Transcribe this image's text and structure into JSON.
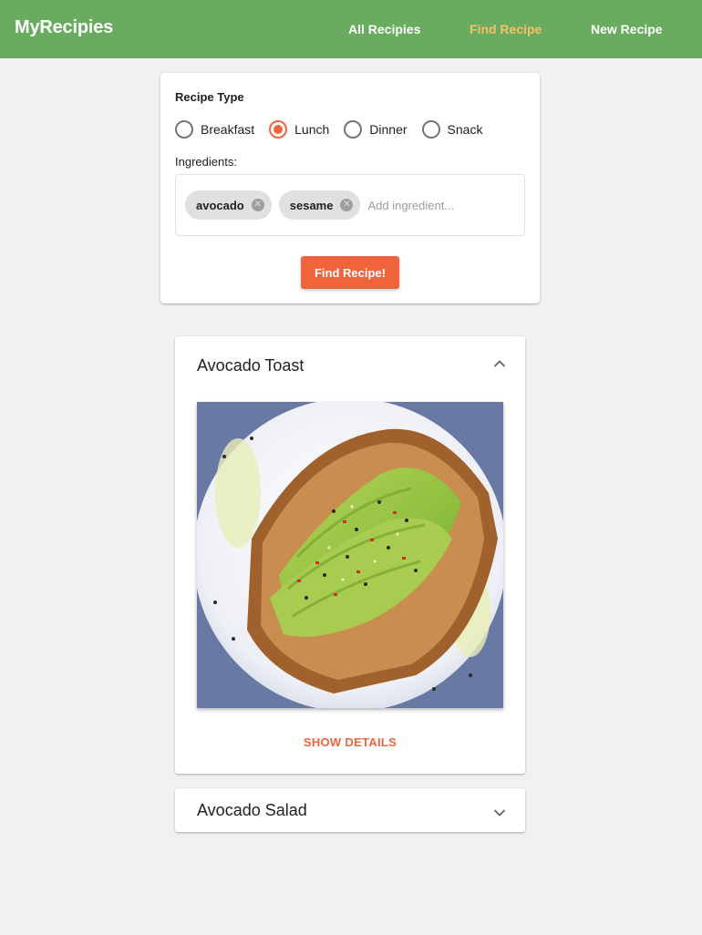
{
  "navbar": {
    "brand": "MyRecipies",
    "links": [
      {
        "label": "All Recipies",
        "active": false
      },
      {
        "label": "Find Recipe",
        "active": true
      },
      {
        "label": "New Recipe",
        "active": false
      }
    ],
    "color": "#69ac5f",
    "active_color": "#f6c067"
  },
  "search": {
    "recipe_type_label": "Recipe Type",
    "options": [
      {
        "label": "Breakfast",
        "checked": false
      },
      {
        "label": "Lunch",
        "checked": true
      },
      {
        "label": "Dinner",
        "checked": false
      },
      {
        "label": "Snack",
        "checked": false
      }
    ],
    "ingredients_label": "Ingredients:",
    "chips": [
      "avocado",
      "sesame"
    ],
    "ingredient_placeholder": "Add ingredient...",
    "button_label": "Find Recipe!",
    "accent_color": "#f0643c"
  },
  "results": [
    {
      "title": "Avocado Toast",
      "expanded": true,
      "action_label": "SHOW DETAILS"
    },
    {
      "title": "Avocado Salad",
      "expanded": false
    }
  ],
  "icons": {
    "chip_close": "close-circle-icon",
    "expanded": "chevron-up-icon",
    "collapsed": "chevron-down-icon"
  }
}
